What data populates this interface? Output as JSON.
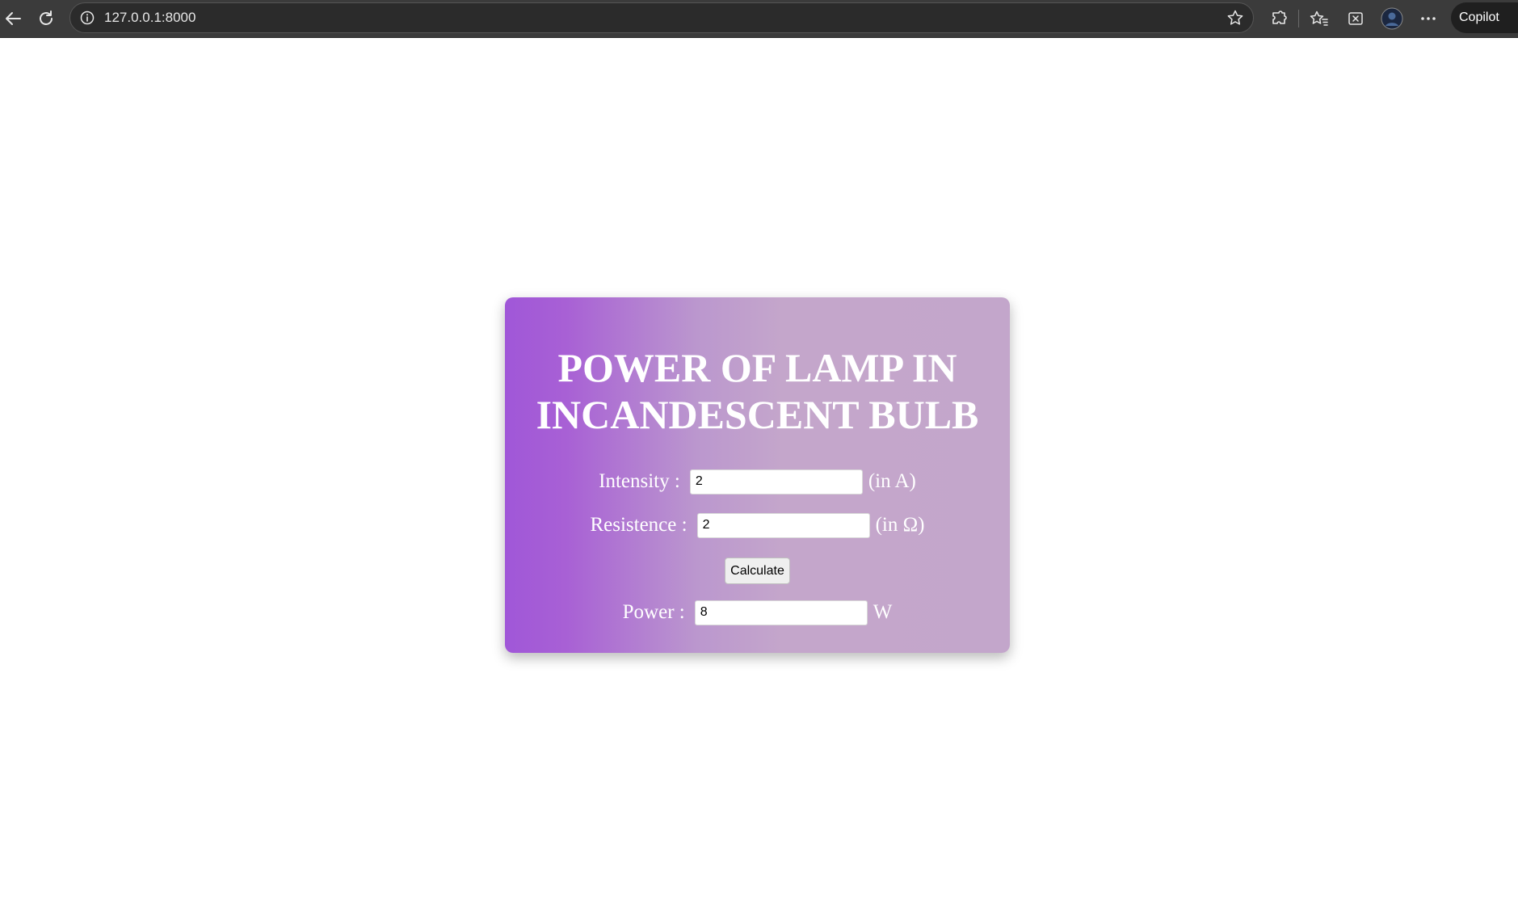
{
  "browser": {
    "url": "127.0.0.1:8000",
    "copilot_label": "Copilot",
    "icons": {
      "back": "back-arrow-icon",
      "reload": "reload-icon",
      "site_info": "info-icon",
      "favorite": "star-icon",
      "extensions": "puzzle-icon",
      "favorites": "favorites-icon",
      "screenshot": "screenshot-icon",
      "profile": "avatar",
      "menu": "more-icon"
    }
  },
  "form": {
    "title": "POWER OF LAMP IN INCANDESCENT BULB",
    "intensity": {
      "label": "Intensity :",
      "value": "2",
      "unit": "(in A)"
    },
    "resistance": {
      "label": "Resistence :",
      "value": "2",
      "unit": "(in Ω)"
    },
    "calculate_label": "Calculate",
    "power": {
      "label": "Power :",
      "value": "8",
      "unit": "W"
    }
  },
  "colors": {
    "gradient_start": "#a057d8",
    "gradient_end": "#c3a6cb",
    "toolbar": "#3b3b3b"
  }
}
